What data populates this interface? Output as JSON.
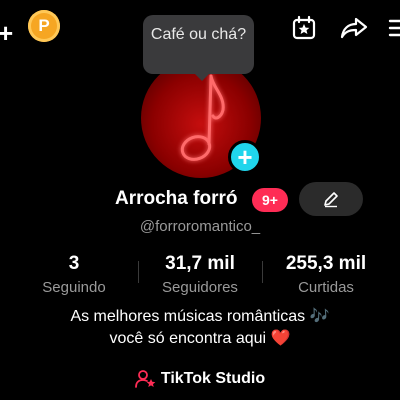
{
  "top_bar": {
    "add_icon": "plus-icon",
    "coin_label": "P",
    "coin_color": "#f6a623",
    "calendar_icon": "calendar-star-icon",
    "share_icon": "share-arrow-icon",
    "menu_icon": "hamburger-menu-icon"
  },
  "tooltip": {
    "text": "Café ou chá?"
  },
  "profile": {
    "avatar_icon": "music-note-icon",
    "avatar_color": "#c50e0e",
    "add_badge_icon": "plus-icon",
    "add_badge_color": "#20d5ec",
    "display_name": "Arrocha forró",
    "notification_badge": "9+",
    "notification_badge_color": "#fe2c55",
    "edit_icon": "pencil-icon",
    "username": "@forroromantico_"
  },
  "stats": [
    {
      "value": "3",
      "label": "Seguindo"
    },
    {
      "value": "31,7 mil",
      "label": "Seguidores"
    },
    {
      "value": "255,3 mil",
      "label": "Curtidas"
    }
  ],
  "bio": {
    "line1": "As melhores músicas românticas 🎶",
    "line2": "você só encontra aqui ❤️"
  },
  "studio": {
    "icon": "person-star-icon",
    "label": "TikTok Studio"
  }
}
